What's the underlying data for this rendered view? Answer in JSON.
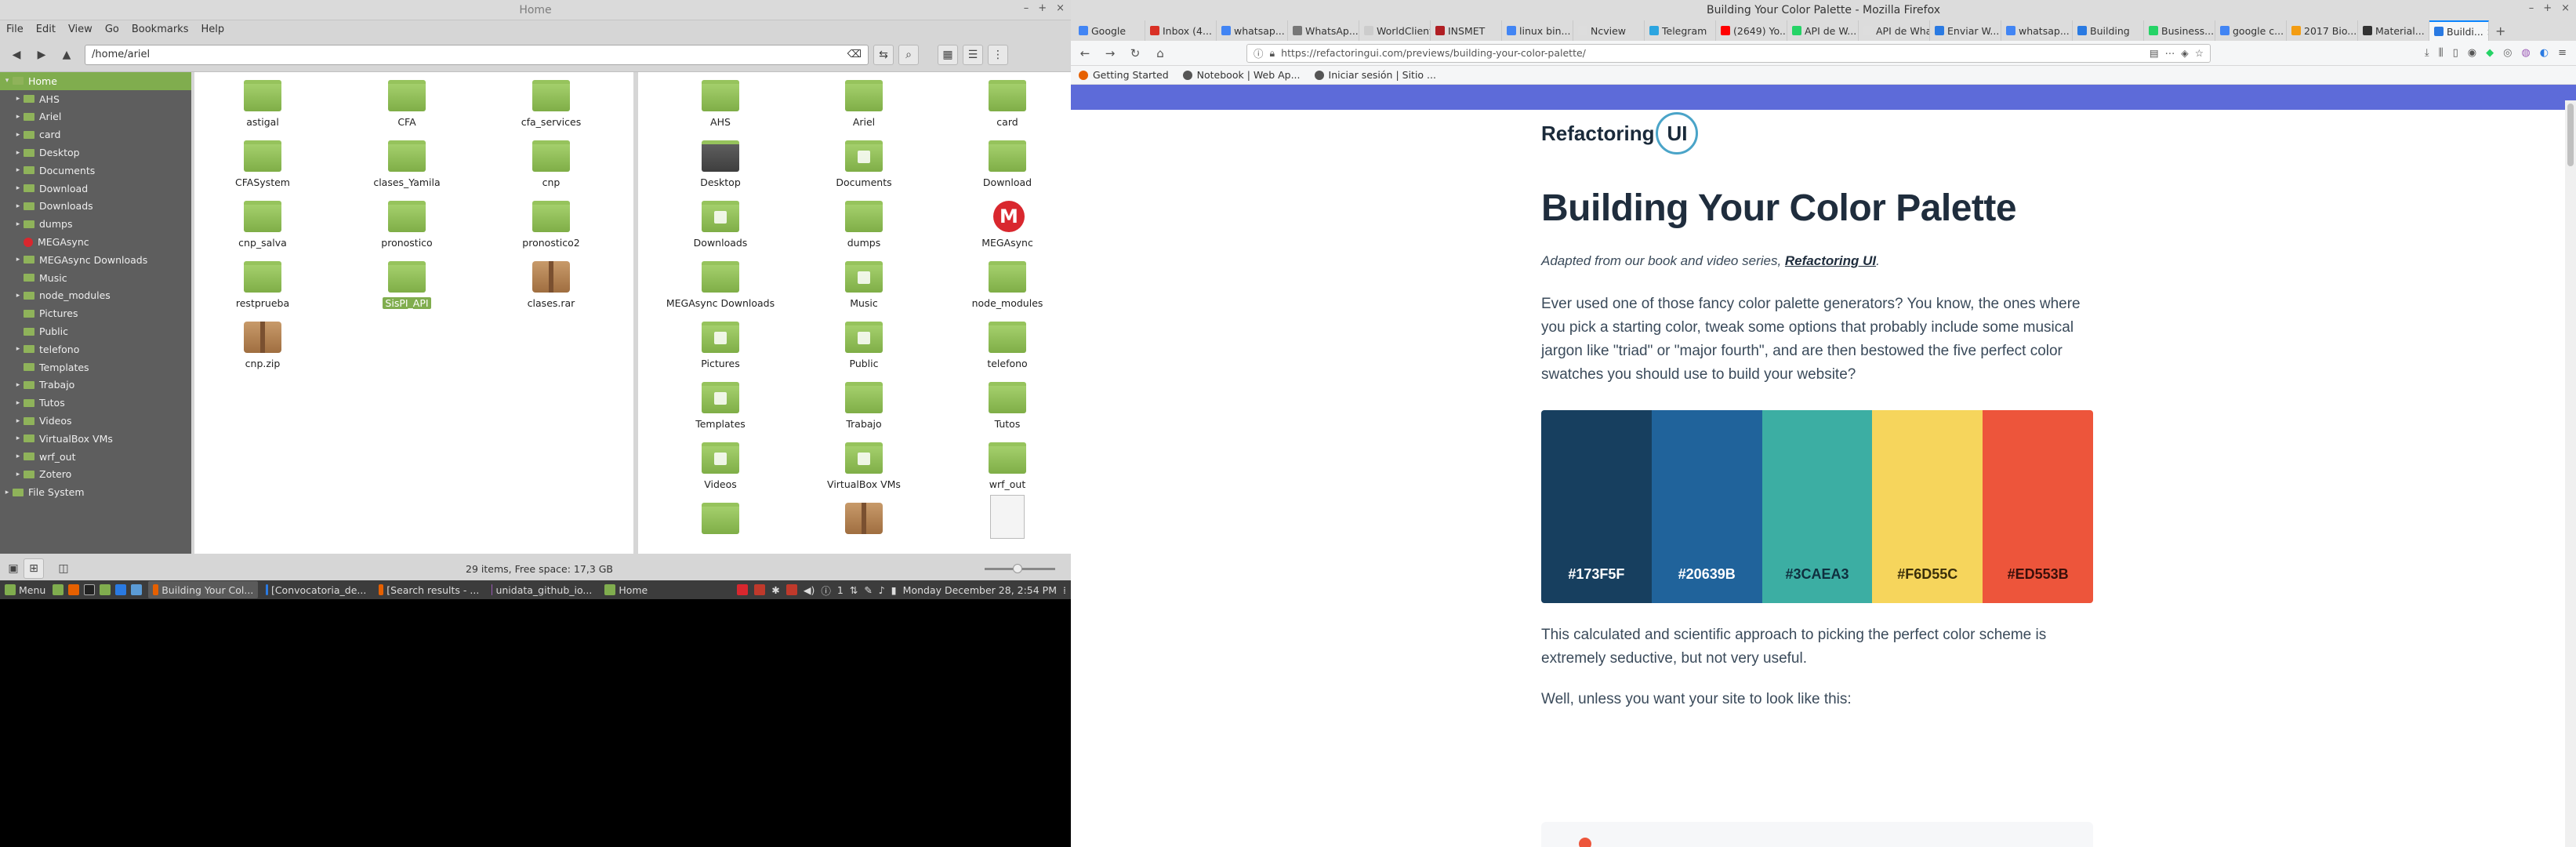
{
  "file_manager": {
    "title": "Home",
    "menu": [
      "File",
      "Edit",
      "View",
      "Go",
      "Bookmarks",
      "Help"
    ],
    "path": "/home/ariel",
    "sidebar": [
      {
        "label": "Home",
        "level": 0,
        "expander": "▾",
        "selected": true
      },
      {
        "label": "AHS",
        "level": 1,
        "expander": "▸"
      },
      {
        "label": "Ariel",
        "level": 1,
        "expander": "▸"
      },
      {
        "label": "card",
        "level": 1,
        "expander": "▸"
      },
      {
        "label": "Desktop",
        "level": 1,
        "expander": "▸"
      },
      {
        "label": "Documents",
        "level": 1,
        "expander": "▸"
      },
      {
        "label": "Download",
        "level": 1,
        "expander": "▸"
      },
      {
        "label": "Downloads",
        "level": 1,
        "expander": "▸"
      },
      {
        "label": "dumps",
        "level": 1,
        "expander": "▸"
      },
      {
        "label": "MEGAsync",
        "level": 1,
        "expander": "",
        "mega": true
      },
      {
        "label": "MEGAsync Downloads",
        "level": 1,
        "expander": "▸"
      },
      {
        "label": "Music",
        "level": 1,
        "expander": ""
      },
      {
        "label": "node_modules",
        "level": 1,
        "expander": "▸"
      },
      {
        "label": "Pictures",
        "level": 1,
        "expander": ""
      },
      {
        "label": "Public",
        "level": 1,
        "expander": ""
      },
      {
        "label": "telefono",
        "level": 1,
        "expander": "▸"
      },
      {
        "label": "Templates",
        "level": 1,
        "expander": ""
      },
      {
        "label": "Trabajo",
        "level": 1,
        "expander": "▸"
      },
      {
        "label": "Tutos",
        "level": 1,
        "expander": "▸"
      },
      {
        "label": "Videos",
        "level": 1,
        "expander": "▸"
      },
      {
        "label": "VirtualBox VMs",
        "level": 1,
        "expander": "▸"
      },
      {
        "label": "wrf_out",
        "level": 1,
        "expander": "▸"
      },
      {
        "label": "Zotero",
        "level": 1,
        "expander": "▸"
      },
      {
        "label": "File System",
        "level": 0,
        "expander": "▸"
      }
    ],
    "pane1": [
      {
        "label": "astigal",
        "type": "folder"
      },
      {
        "label": "CFA",
        "type": "folder"
      },
      {
        "label": "cfa_services",
        "type": "folder"
      },
      {
        "label": "CFASystem",
        "type": "folder"
      },
      {
        "label": "clases_Yamila",
        "type": "folder"
      },
      {
        "label": "cnp",
        "type": "folder"
      },
      {
        "label": "cnp_salva",
        "type": "folder"
      },
      {
        "label": "pronostico",
        "type": "folder"
      },
      {
        "label": "pronostico2",
        "type": "folder"
      },
      {
        "label": "restprueba",
        "type": "folder"
      },
      {
        "label": "SisPI_API",
        "type": "folder",
        "selected": true
      },
      {
        "label": "clases.rar",
        "type": "archive"
      },
      {
        "label": "cnp.zip",
        "type": "archive"
      }
    ],
    "pane2": [
      {
        "label": "AHS",
        "type": "folder"
      },
      {
        "label": "Ariel",
        "type": "folder"
      },
      {
        "label": "card",
        "type": "folder"
      },
      {
        "label": "Desktop",
        "type": "folder dark"
      },
      {
        "label": "Documents",
        "type": "folder doc"
      },
      {
        "label": "Download",
        "type": "folder"
      },
      {
        "label": "Downloads",
        "type": "folder dl"
      },
      {
        "label": "dumps",
        "type": "folder"
      },
      {
        "label": "MEGAsync",
        "type": "mega"
      },
      {
        "label": "MEGAsync Downloads",
        "type": "folder"
      },
      {
        "label": "Music",
        "type": "folder mus"
      },
      {
        "label": "node_modules",
        "type": "folder"
      },
      {
        "label": "Pictures",
        "type": "folder pic"
      },
      {
        "label": "Public",
        "type": "folder usr"
      },
      {
        "label": "telefono",
        "type": "folder"
      },
      {
        "label": "Templates",
        "type": "folder tpl"
      },
      {
        "label": "Trabajo",
        "type": "folder"
      },
      {
        "label": "Tutos",
        "type": "folder"
      },
      {
        "label": "Videos",
        "type": "folder vid"
      },
      {
        "label": "VirtualBox VMs",
        "type": "folder vb"
      },
      {
        "label": "wrf_out",
        "type": "folder"
      },
      {
        "label": "",
        "type": "folder"
      },
      {
        "label": "",
        "type": "archive"
      },
      {
        "label": "",
        "type": "thumb"
      }
    ],
    "status": "29 items, Free space: 17,3 GB",
    "mega_letter": "M"
  },
  "panel": {
    "menu_label": "Menu",
    "windows": [
      {
        "label": "Building Your Col...",
        "color": "#e66000",
        "active": true
      },
      {
        "label": "[Convocatoria_de...",
        "color": "#2a7ae2",
        "active": false
      },
      {
        "label": "[Search results - ...",
        "color": "#e66000",
        "active": false
      },
      {
        "label": "unidata_github_io...",
        "color": "#9b59b6",
        "active": false
      },
      {
        "label": "Home",
        "color": "#80ad4e",
        "active": false
      }
    ],
    "clock": "Monday December 28,  2:54 PM",
    "tray_count": "1"
  },
  "firefox": {
    "window_title": "Building Your Color Palette - Mozilla Firefox",
    "tabs": [
      {
        "label": "Google",
        "color": "#4285f4"
      },
      {
        "label": "Inbox (4...",
        "color": "#d93025"
      },
      {
        "label": "whatsap...",
        "color": "#4285f4"
      },
      {
        "label": "WhatsAp...",
        "color": "#777"
      },
      {
        "label": "WorldClient",
        "color": "#ccc"
      },
      {
        "label": "INSMET",
        "color": "#b01e23"
      },
      {
        "label": "linux bin...",
        "color": "#4285f4"
      },
      {
        "label": "Ncview",
        "color": "#ddd"
      },
      {
        "label": "Telegram",
        "color": "#2ca5e0"
      },
      {
        "label": "(2649) Yo...",
        "color": "#ff0000"
      },
      {
        "label": "API de W...",
        "color": "#25d366"
      },
      {
        "label": "API de Whats...",
        "color": "#ddd"
      },
      {
        "label": "Enviar W...",
        "color": "#2a7ae2"
      },
      {
        "label": "whatsap...",
        "color": "#4285f4"
      },
      {
        "label": "Building",
        "color": "#2a7ae2"
      },
      {
        "label": "Business...",
        "color": "#25d366"
      },
      {
        "label": "google c...",
        "color": "#4285f4"
      },
      {
        "label": "2017 Bio...",
        "color": "#f39c12"
      },
      {
        "label": "Material...",
        "color": "#333"
      },
      {
        "label": "Buildi...",
        "color": "#2a7ae2",
        "active": true
      }
    ],
    "url": "https://refactoringui.com/previews/building-your-color-palette/",
    "bookmarks": [
      "Getting Started",
      "Notebook | Web Ap...",
      "Iniciar sesión | Sitio ..."
    ],
    "page": {
      "logo_text": "Refactoring",
      "logo_mark": "UI",
      "title": "Building Your Color Palette",
      "subtitle_prefix": "Adapted from our book and video series, ",
      "subtitle_link": "Refactoring UI",
      "subtitle_suffix": ".",
      "intro": "Ever used one of those fancy color palette generators? You know, the ones where you pick a starting color, tweak some options that probably include some musical jargon like \"triad\" or \"major fourth\", and are then bestowed the five perfect color swatches you should use to build your website?",
      "swatches": [
        {
          "label": "#173F5F",
          "color": "#173F5F",
          "text": "#ffffff"
        },
        {
          "label": "#20639B",
          "color": "#20639B",
          "text": "#ffffff"
        },
        {
          "label": "#3CAEA3",
          "color": "#3CAEA3",
          "text": "#0f2f3f"
        },
        {
          "label": "#F6D55C",
          "color": "#F6D55C",
          "text": "#3a2f0a"
        },
        {
          "label": "#ED553B",
          "color": "#ED553B",
          "text": "#3a0f0a"
        }
      ],
      "para2": "This calculated and scientific approach to picking the perfect color scheme is extremely seductive, but not very useful.",
      "para3": "Well, unless you want your site to look like this:"
    }
  }
}
